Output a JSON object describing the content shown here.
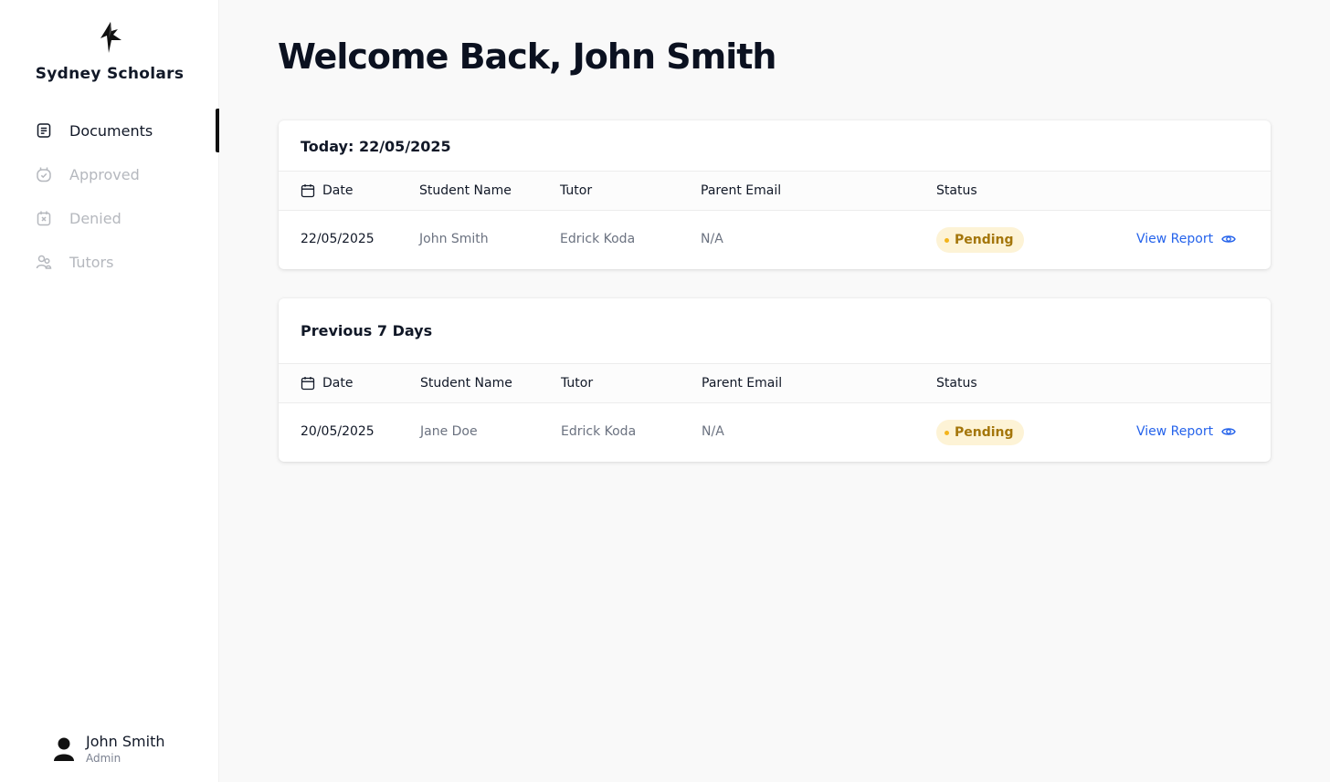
{
  "brand": {
    "name": "Sydney Scholars",
    "logo_icon": "bird-logo-icon"
  },
  "nav": [
    {
      "label": "Documents",
      "icon": "document-icon",
      "active": true
    },
    {
      "label": "Approved",
      "icon": "calendar-check-icon",
      "active": false
    },
    {
      "label": "Denied",
      "icon": "calendar-x-icon",
      "active": false
    },
    {
      "label": "Tutors",
      "icon": "users-icon",
      "active": false
    }
  ],
  "user": {
    "name": "John Smith",
    "role": "Admin"
  },
  "page": {
    "title": "Welcome Back, John Smith"
  },
  "columns": {
    "date": "Date",
    "student": "Student Name",
    "tutor": "Tutor",
    "parent_email": "Parent Email",
    "status": "Status"
  },
  "today": {
    "title": "Today: 22/05/2025",
    "rows": [
      {
        "date": "22/05/2025",
        "student": "John Smith",
        "tutor": "Edrick Koda",
        "parent_email": "N/A",
        "status": "Pending",
        "action": "View Report"
      }
    ]
  },
  "previous": {
    "title": "Previous 7 Days",
    "rows": [
      {
        "date": "20/05/2025",
        "student": "Jane Doe",
        "tutor": "Edrick Koda",
        "parent_email": "N/A",
        "status": "Pending",
        "action": "View Report"
      }
    ]
  },
  "colors": {
    "accent": "#2563eb",
    "pending_bg": "#fdf3d6",
    "pending_text": "#a4760b",
    "pending_dot": "#f3b41b"
  }
}
